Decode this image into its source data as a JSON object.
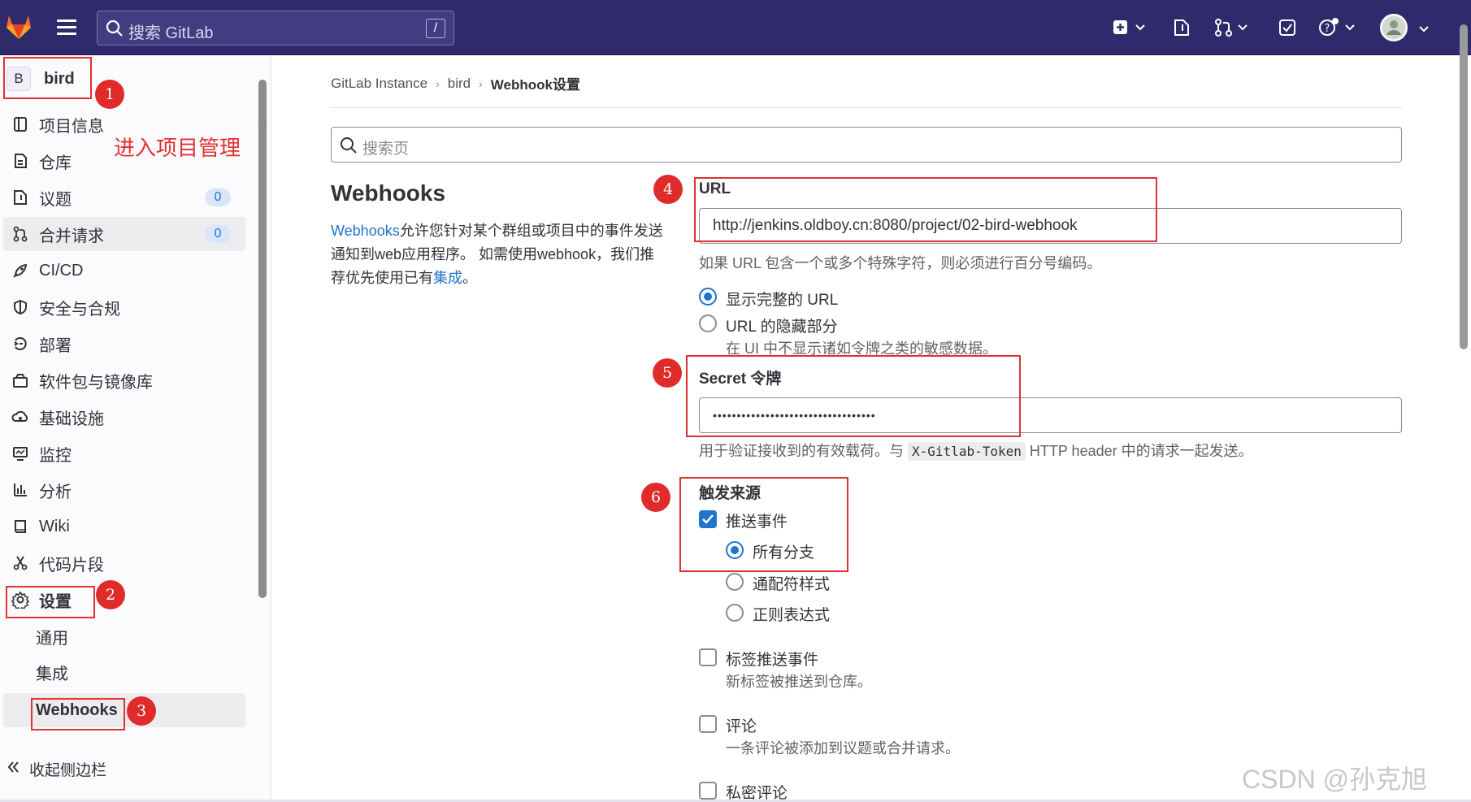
{
  "topbar": {
    "search_placeholder": "搜索 GitLab",
    "search_shortcut": "/"
  },
  "sidebar": {
    "project_initial": "B",
    "project_name": "bird",
    "items": [
      {
        "label": "项目信息",
        "icon": "project-info-icon"
      },
      {
        "label": "仓库",
        "icon": "repository-icon"
      },
      {
        "label": "议题",
        "icon": "issues-icon",
        "badge": "0"
      },
      {
        "label": "合并请求",
        "icon": "merge-request-icon",
        "badge": "0"
      },
      {
        "label": "CI/CD",
        "icon": "rocket-icon"
      },
      {
        "label": "安全与合规",
        "icon": "shield-icon"
      },
      {
        "label": "部署",
        "icon": "deploy-icon"
      },
      {
        "label": "软件包与镜像库",
        "icon": "package-icon"
      },
      {
        "label": "基础设施",
        "icon": "cloud-icon"
      },
      {
        "label": "监控",
        "icon": "monitor-icon"
      },
      {
        "label": "分析",
        "icon": "chart-icon"
      },
      {
        "label": "Wiki",
        "icon": "book-icon"
      },
      {
        "label": "代码片段",
        "icon": "snippet-icon"
      },
      {
        "label": "设置",
        "icon": "gear-icon"
      }
    ],
    "settings_sub": [
      "通用",
      "集成",
      "Webhooks"
    ],
    "collapse_label": "收起侧边栏"
  },
  "breadcrumb": [
    "GitLab Instance",
    "bird",
    "Webhook设置"
  ],
  "page_search_placeholder": "搜索页",
  "webhooks": {
    "title": "Webhooks",
    "desc_link": "Webhooks",
    "desc_text": "允许您针对某个群组或项目中的事件发送通知到web应用程序。 如需使用webhook，我们推荐优先使用已有",
    "desc_link2": "集成",
    "desc_end": "。"
  },
  "form": {
    "url_label": "URL",
    "url_value": "http://jenkins.oldboy.cn:8080/project/02-bird-webhook",
    "url_help": "如果 URL 包含一个或多个特殊字符，则必须进行百分号编码。",
    "show_full_url": "显示完整的 URL",
    "mask_url": "URL 的隐藏部分",
    "mask_help": "在 UI 中不显示诸如令牌之类的敏感数据。",
    "secret_label": "Secret 令牌",
    "secret_value": "••••••••••••••••••••••••••••••••••",
    "secret_help_pre": "用于验证接收到的有效载荷。与",
    "secret_help_code": "X-Gitlab-Token",
    "secret_help_post": "HTTP header 中的请求一起发送。",
    "trigger_label": "触发来源",
    "push_events": "推送事件",
    "all_branches": "所有分支",
    "wildcard": "通配符样式",
    "regex": "正则表达式",
    "tag_push": "标签推送事件",
    "tag_push_help": "新标签被推送到仓库。",
    "comments": "评论",
    "comments_help": "一条评论被添加到议题或合并请求。",
    "confidential_comments": "私密评论"
  },
  "annotations": {
    "n1": "1",
    "n2": "2",
    "n3": "3",
    "n4": "4",
    "n5": "5",
    "n6": "6",
    "enter_project": "进入项目管理"
  },
  "watermark": "CSDN @孙克旭"
}
